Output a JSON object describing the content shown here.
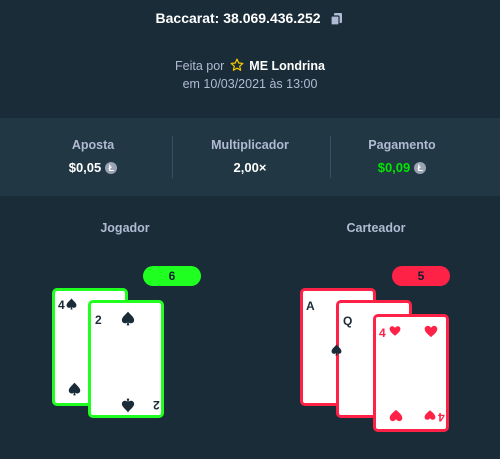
{
  "header": {
    "title": "Baccarat: 38.069.436.252",
    "made_by_prefix": "Feita por",
    "user": "ME Londrina",
    "date": "em 10/03/2021 às 13:00"
  },
  "stats": {
    "bet_label": "Aposta",
    "bet_value": "$0,05",
    "multiplier_label": "Multiplicador",
    "multiplier_value": "2,00×",
    "payout_label": "Pagamento",
    "payout_value": "$0,09"
  },
  "player": {
    "label": "Jogador",
    "score": "6",
    "cards": [
      {
        "rank": "4",
        "suit": "spade"
      },
      {
        "rank": "2",
        "suit": "spade"
      }
    ]
  },
  "banker": {
    "label": "Carteador",
    "score": "5",
    "cards": [
      {
        "rank": "A",
        "suit": "spade"
      },
      {
        "rank": "Q",
        "suit": "spade"
      },
      {
        "rank": "4",
        "suit": "heart"
      }
    ]
  },
  "colors": {
    "background": "#1a2c38",
    "panel": "#213743",
    "win": "#1fff20",
    "lose": "#fe2247",
    "muted": "#b1bad3"
  }
}
